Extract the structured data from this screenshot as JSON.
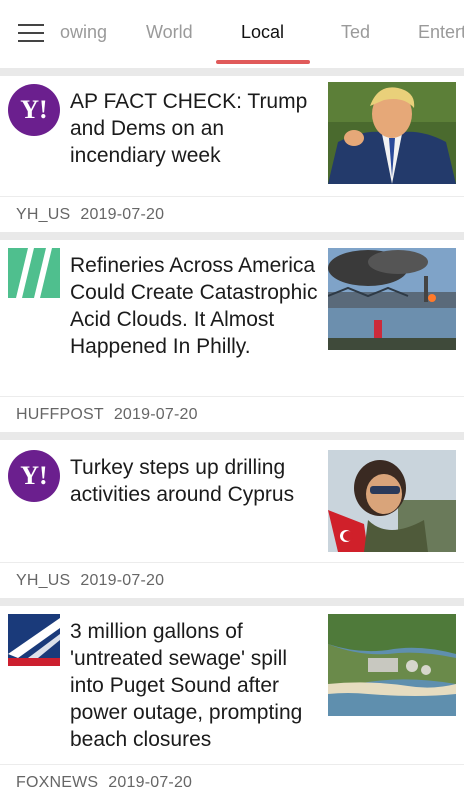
{
  "tabs": [
    "owing",
    "World",
    "Local",
    "Ted",
    "Entert"
  ],
  "articles": [
    {
      "source": "YH_US",
      "date": "2019-07-20",
      "headline": "AP FACT CHECK: Trump and Dems on an incendiary week",
      "logo": "yahoo-logo",
      "logo_text": "Y!"
    },
    {
      "source": "HUFFPOST",
      "date": "2019-07-20",
      "headline": "Refineries Across America Could Create Catastrophic Acid Clouds. It Almost Happened In Philly.",
      "logo": "huffpost-logo"
    },
    {
      "source": "YH_US",
      "date": "2019-07-20",
      "headline": "Turkey steps up drilling activities around Cyprus",
      "logo": "yahoo-logo",
      "logo_text": "Y!"
    },
    {
      "source": "FOXNEWS",
      "date": "2019-07-20",
      "headline": "3 million gallons of 'untreated sewage' spill into Puget Sound after power outage, prompting beach closures",
      "logo": "foxnews-logo"
    }
  ],
  "colors": {
    "accent": "#e05a5a",
    "yahoo": "#6b1f8e",
    "huffpost": "#4fbf8e",
    "fox_blue": "#1a3a7a",
    "fox_red": "#cc1f2f"
  }
}
